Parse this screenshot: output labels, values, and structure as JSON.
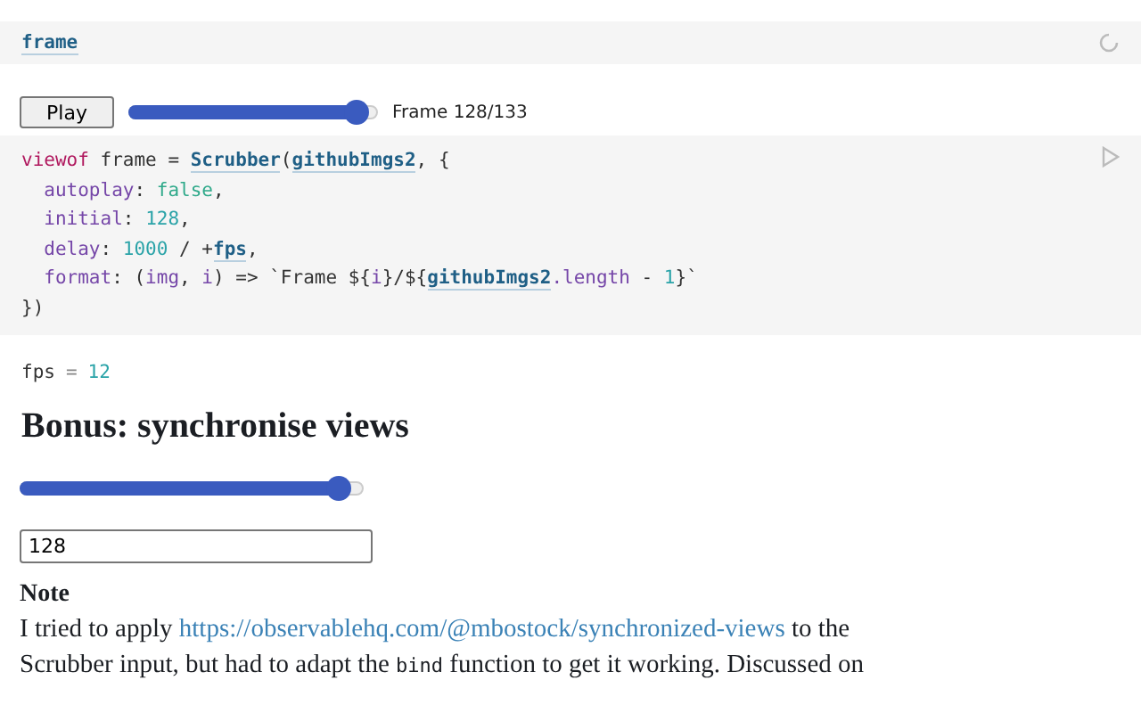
{
  "frame_cell": {
    "name": "frame"
  },
  "scrubber": {
    "button": "Play",
    "level": 0.96,
    "label": "Frame 128/133"
  },
  "code": [
    [
      {
        "kind": "keyword",
        "text": "viewof"
      },
      {
        "kind": "plain",
        "text": " frame = "
      },
      {
        "kind": "ref",
        "text": "Scrubber"
      },
      {
        "kind": "plain",
        "text": "("
      },
      {
        "kind": "ref",
        "text": "githubImgs2"
      },
      {
        "kind": "plain",
        "text": ", {"
      }
    ],
    [
      {
        "kind": "prop",
        "text": "autoplay"
      },
      {
        "kind": "plain",
        "text": ": "
      },
      {
        "kind": "bool",
        "text": "false"
      },
      {
        "kind": "plain",
        "text": ","
      }
    ],
    [
      {
        "kind": "prop",
        "text": "initial"
      },
      {
        "kind": "plain",
        "text": ": "
      },
      {
        "kind": "number",
        "text": "128"
      },
      {
        "kind": "plain",
        "text": ","
      }
    ],
    [
      {
        "kind": "prop",
        "text": "delay"
      },
      {
        "kind": "plain",
        "text": ": "
      },
      {
        "kind": "number",
        "text": "1000"
      },
      {
        "kind": "plain",
        "text": " / +"
      },
      {
        "kind": "ref",
        "text": "fps"
      },
      {
        "kind": "plain",
        "text": ","
      }
    ],
    [
      {
        "kind": "prop",
        "text": "format"
      },
      {
        "kind": "plain",
        "text": ": ("
      },
      {
        "kind": "prop",
        "text": "img"
      },
      {
        "kind": "plain",
        "text": ", "
      },
      {
        "kind": "prop",
        "text": "i"
      },
      {
        "kind": "plain",
        "text": ") => "
      },
      {
        "kind": "string",
        "text": "`Frame ${"
      },
      {
        "kind": "prop",
        "text": "i"
      },
      {
        "kind": "string",
        "text": "}/${"
      },
      {
        "kind": "ref",
        "text": "githubImgs2"
      },
      {
        "kind": "prop",
        "text": ".length"
      },
      {
        "kind": "plain",
        "text": " - "
      },
      {
        "kind": "number",
        "text": "1"
      },
      {
        "kind": "string",
        "text": "}`"
      }
    ],
    [
      {
        "kind": "plain",
        "text": "})"
      }
    ]
  ],
  "fps": {
    "name": "fps",
    "op": "=",
    "value": "12"
  },
  "heading": "Bonus: synchronise views",
  "sync_slider": {
    "level": 0.96
  },
  "sync_input": {
    "value": "128"
  },
  "note": {
    "title": "Note",
    "paragraph": [
      {
        "kind": "text",
        "text": "I tried to apply "
      },
      {
        "kind": "link",
        "text": "https://observablehq.com/@mbostock/synchronized-views"
      },
      {
        "kind": "text",
        "text": " to the Scrubber input, but had to adapt the "
      },
      {
        "kind": "code",
        "text": "bind"
      },
      {
        "kind": "text",
        "text": " function to get it working. Discussed on"
      }
    ]
  }
}
